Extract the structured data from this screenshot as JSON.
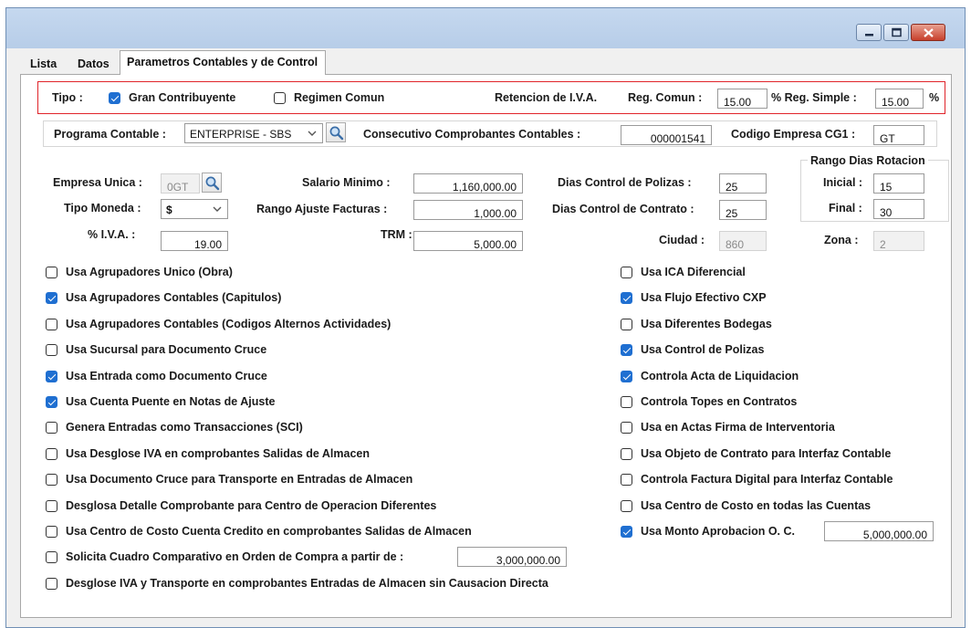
{
  "window": {
    "controls": [
      "minimize-icon",
      "maximize-icon",
      "close-icon"
    ]
  },
  "tabs": [
    "Lista",
    "Datos",
    "Parametros Contables y de Control"
  ],
  "tipo": {
    "label": "Tipo :",
    "gran_contribuyente": {
      "label": "Gran Contribuyente",
      "checked": true
    },
    "regimen_comun": {
      "label": "Regimen Comun",
      "checked": false
    },
    "retencion_label": "Retencion de I.V.A.",
    "reg_comun_label": "Reg. Comun :",
    "reg_comun_value": "15.00",
    "reg_simple_label": "% Reg. Simple :",
    "reg_simple_value": "15.00",
    "pct": "%"
  },
  "programa": {
    "label": "Programa Contable :",
    "value": "ENTERPRISE - SBS",
    "consecutivo_label": "Consecutivo Comprobantes Contables :",
    "consecutivo_value": "000001541",
    "codigo_label": "Codigo Empresa CG1 :",
    "codigo_value": "GT"
  },
  "general": {
    "empresa_unica_label": "Empresa Unica :",
    "empresa_unica_value": "0GT",
    "tipo_moneda_label": "Tipo Moneda :",
    "tipo_moneda_value": "$",
    "iva_label": "% I.V.A. :",
    "iva_value": "19.00",
    "salario_label": "Salario Minimo :",
    "salario_value": "1,160,000.00",
    "rango_ajuste_label": "Rango Ajuste Facturas :",
    "rango_ajuste_value": "1,000.00",
    "trm_label": "TRM :",
    "trm_value": "5,000.00",
    "dias_polizas_label": "Dias Control de Polizas :",
    "dias_polizas_value": "25",
    "dias_contrato_label": "Dias Control de Contrato :",
    "dias_contrato_value": "25",
    "ciudad_label": "Ciudad :",
    "ciudad_value": "860",
    "zona_label": "Zona :",
    "zona_value": "2"
  },
  "rango": {
    "title": "Rango Dias Rotacion",
    "inicial_label": "Inicial :",
    "inicial_value": "15",
    "final_label": "Final :",
    "final_value": "30"
  },
  "left_options": [
    {
      "label": "Usa Agrupadores Unico (Obra)",
      "checked": false
    },
    {
      "label": "Usa Agrupadores Contables (Capitulos)",
      "checked": true
    },
    {
      "label": "Usa Agrupadores Contables (Codigos Alternos Actividades)",
      "checked": false
    },
    {
      "label": "Usa Sucursal para Documento Cruce",
      "checked": false
    },
    {
      "label": "Usa Entrada como Documento Cruce",
      "checked": true
    },
    {
      "label": "Usa Cuenta Puente en Notas de Ajuste",
      "checked": true
    },
    {
      "label": "Genera Entradas como Transacciones (SCI)",
      "checked": false
    },
    {
      "label": "Usa Desglose IVA en comprobantes Salidas de Almacen",
      "checked": false
    },
    {
      "label": "Usa Documento Cruce para Transporte en Entradas de Almacen",
      "checked": false
    },
    {
      "label": "Desglosa Detalle Comprobante para Centro de Operacion Diferentes",
      "checked": false
    },
    {
      "label": "Usa Centro de Costo Cuenta Credito en comprobantes Salidas de Almacen",
      "checked": false
    },
    {
      "label": "Solicita Cuadro Comparativo en Orden de Compra a partir de :",
      "checked": false,
      "value": "3,000,000.00"
    },
    {
      "label": "Desglose IVA y Transporte en comprobantes Entradas de Almacen sin Causacion Directa",
      "checked": false
    }
  ],
  "right_options": [
    {
      "label": "Usa ICA Diferencial",
      "checked": false
    },
    {
      "label": "Usa Flujo Efectivo CXP",
      "checked": true
    },
    {
      "label": "Usa Diferentes Bodegas",
      "checked": false
    },
    {
      "label": "Usa Control de Polizas",
      "checked": true
    },
    {
      "label": "Controla Acta de Liquidacion",
      "checked": true
    },
    {
      "label": "Controla Topes en Contratos",
      "checked": false
    },
    {
      "label": "Usa en Actas Firma de Interventoria",
      "checked": false
    },
    {
      "label": "Usa Objeto de Contrato para Interfaz Contable",
      "checked": false
    },
    {
      "label": "Controla Factura Digital para Interfaz Contable",
      "checked": false
    },
    {
      "label": "Usa Centro de Costo en todas las Cuentas",
      "checked": false
    },
    {
      "label": "Usa Monto Aprobacion O. C.",
      "checked": true,
      "value": "5,000,000.00"
    }
  ],
  "colors": {
    "titlebar": "#b7cde8",
    "highlight_border": "#e0242a",
    "check_accent": "#1f6fd1"
  }
}
